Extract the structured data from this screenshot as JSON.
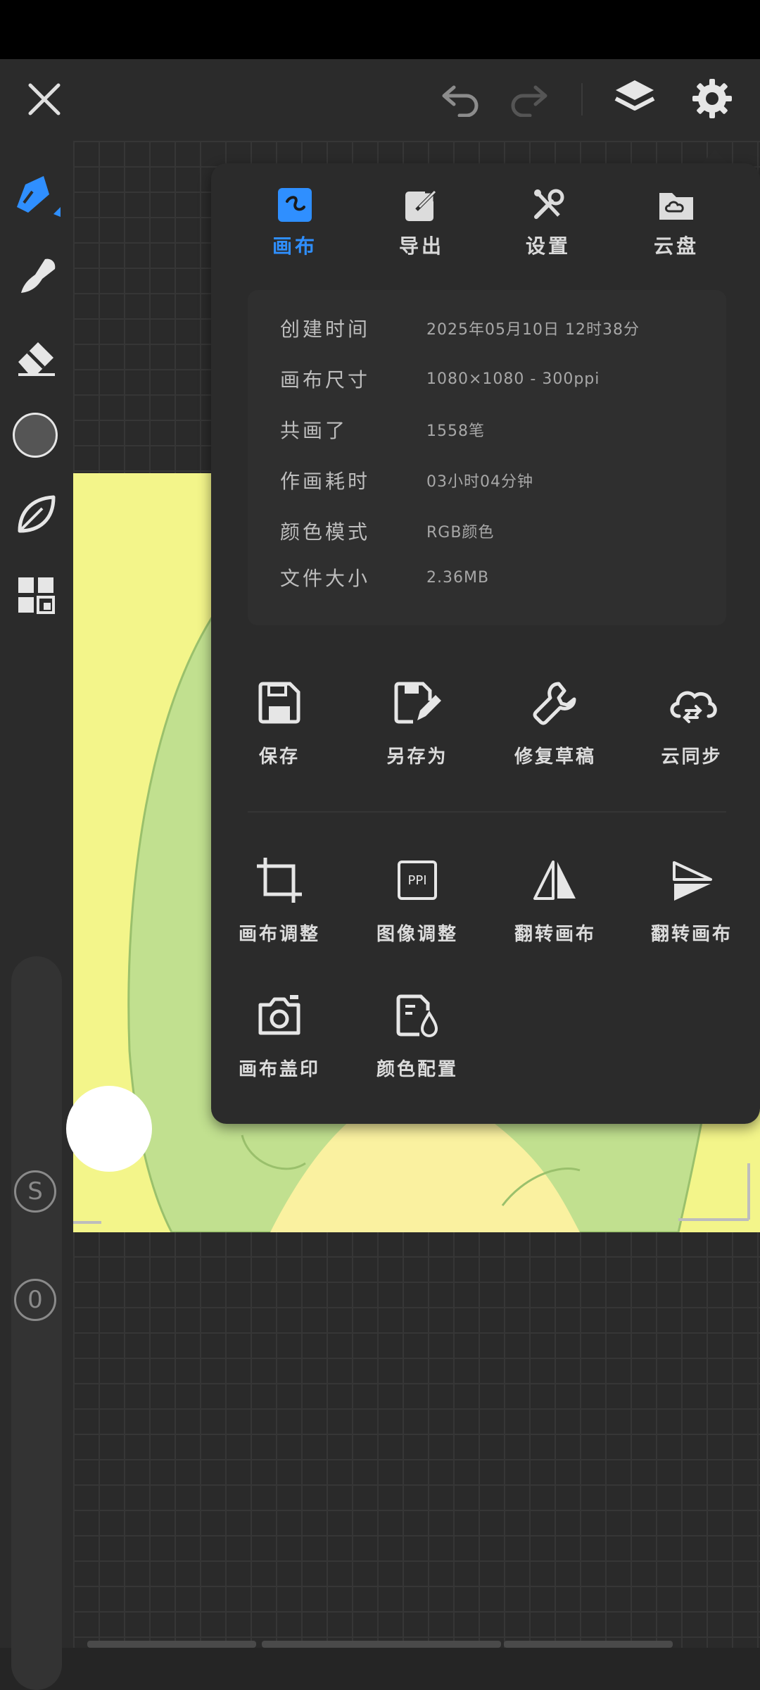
{
  "toolbar": {
    "close": "close",
    "undo": "undo",
    "redo": "redo",
    "layers": "layers",
    "settings": "settings"
  },
  "tools": [
    "brush",
    "smudge",
    "eraser",
    "color",
    "leaf",
    "grid"
  ],
  "slider_badges": {
    "size_badge": "S",
    "opacity_badge": "0"
  },
  "panel": {
    "tabs": [
      {
        "label": "画布",
        "icon": "canvas-icon",
        "active": true
      },
      {
        "label": "导出",
        "icon": "export-icon",
        "active": false
      },
      {
        "label": "设置",
        "icon": "settings-tools-icon",
        "active": false
      },
      {
        "label": "云盘",
        "icon": "cloud-folder-icon",
        "active": false
      }
    ],
    "info": [
      {
        "label": "创建时间",
        "value": "2025年05月10日 12时38分"
      },
      {
        "label": "画布尺寸",
        "value": "1080×1080 - 300ppi"
      },
      {
        "label": "共画了",
        "value": "1558笔"
      },
      {
        "label": "作画耗时",
        "value": "03小时04分钟"
      },
      {
        "label": "颜色模式",
        "value": "RGB颜色"
      },
      {
        "label": "文件大小",
        "value": "2.36MB"
      }
    ],
    "actions_row1": [
      {
        "label": "保存",
        "icon": "save-icon"
      },
      {
        "label": "另存为",
        "icon": "save-as-icon"
      },
      {
        "label": "修复草稿",
        "icon": "repair-icon"
      },
      {
        "label": "云同步",
        "icon": "cloud-sync-icon"
      }
    ],
    "actions_row2": [
      {
        "label": "画布调整",
        "icon": "crop-icon"
      },
      {
        "label": "图像调整",
        "icon": "ppi-icon",
        "icon_text": "PPI"
      },
      {
        "label": "翻转画布",
        "icon": "flip-horizontal-icon"
      },
      {
        "label": "翻转画布",
        "icon": "flip-vertical-icon"
      }
    ],
    "actions_row3": [
      {
        "label": "画布盖印",
        "icon": "camera-icon"
      },
      {
        "label": "颜色配置",
        "icon": "color-profile-icon"
      }
    ]
  },
  "colors": {
    "accent": "#2f8fff",
    "panel": "#2b2b2b",
    "artwork_yellow": "#f3f58a",
    "artwork_green": "#c1e08f"
  }
}
